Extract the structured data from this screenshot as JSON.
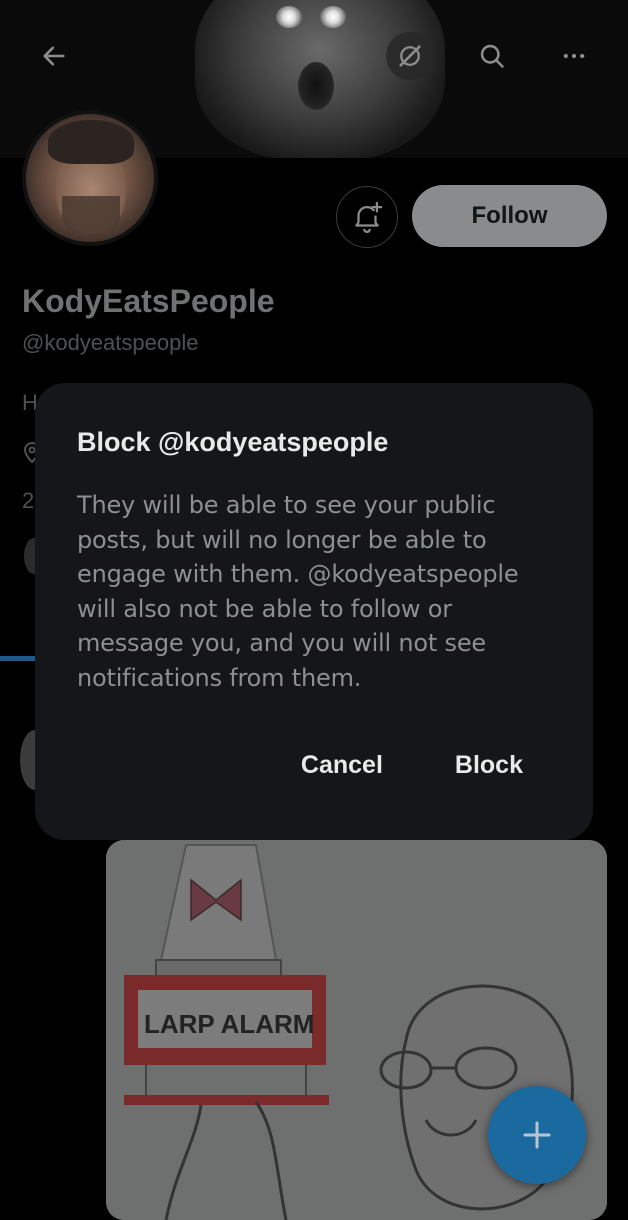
{
  "profile": {
    "display_name": "KodyEatsPeople",
    "handle": "@kodyeatspeople",
    "bio_peek": "He",
    "follow_label": "Follow",
    "count_peek": "2"
  },
  "meme": {
    "sign_text": "LARP ALARM"
  },
  "dialog": {
    "title": "Block @kodyeatspeople",
    "body": "They will be able to see your public posts, but will no longer be able to engage with them. @kodyeatspeople will also not be able to follow or message you, and you will not see notifications from them.",
    "cancel_label": "Cancel",
    "confirm_label": "Block"
  },
  "icons": {
    "back": "arrow-left-icon",
    "grok": "grok-icon",
    "search": "search-icon",
    "more": "more-horizontal-icon",
    "notify": "bell-plus-icon",
    "compose": "plus-icon"
  },
  "colors": {
    "fab": "#1a6aa0",
    "dialog_bg": "#141619",
    "follow_bg": "#8a8b8c"
  }
}
